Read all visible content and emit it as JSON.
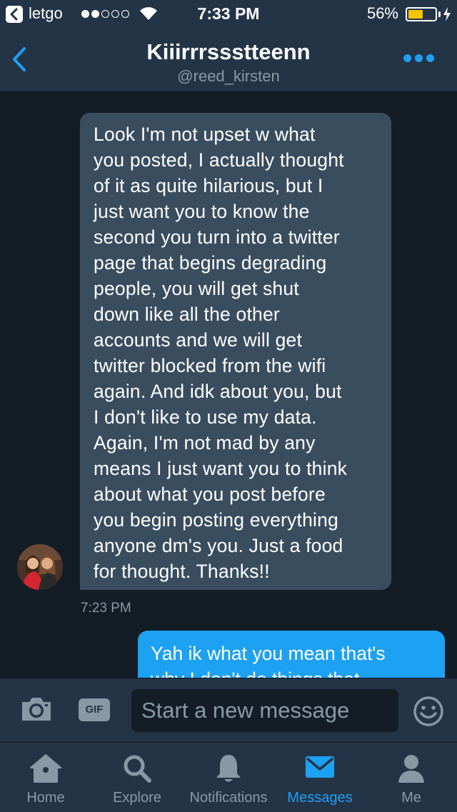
{
  "status_bar": {
    "back_app": "letgo",
    "time": "7:33 PM",
    "battery": "56%",
    "battery_level": 0.56,
    "signal_bars": 2
  },
  "header": {
    "title": "Kiiirrrssstteenn",
    "handle": "@reed_kirsten"
  },
  "conversation": {
    "incoming": {
      "text": "Look I'm not upset w what\nyou posted, I actually thought\nof it as quite hilarious, but I\njust want you to know the\nsecond you turn into a twitter\npage that begins degrading\npeople, you will get shut\ndown like all the other\naccounts and we will get\ntwitter blocked from the wifi\nagain. And idk about you, but\nI don't like to use my data.\nAgain, I'm not mad by any\nmeans I just want you to think\nabout what you post before\nyou begin posting everything\nanyone dm's you. Just a food\nfor thought. Thanks!!",
      "time": "7:23 PM"
    },
    "outgoing": {
      "text": "Yah ik what you mean that's\nwhy I don't do things that"
    }
  },
  "composer": {
    "gif_label": "GIF",
    "placeholder": "Start a new message"
  },
  "tabs": [
    {
      "label": "Home",
      "icon": "home-icon",
      "active": false
    },
    {
      "label": "Explore",
      "icon": "search-icon",
      "active": false
    },
    {
      "label": "Notifications",
      "icon": "bell-icon",
      "active": false
    },
    {
      "label": "Messages",
      "icon": "envelope-icon",
      "active": true
    },
    {
      "label": "Me",
      "icon": "person-icon",
      "active": false
    }
  ],
  "colors": {
    "accent": "#1da1f2",
    "background": "#141d26",
    "bar": "#243447",
    "incoming_bubble": "#3a4d5f",
    "muted": "#8899a6",
    "battery": "#f5c400"
  }
}
